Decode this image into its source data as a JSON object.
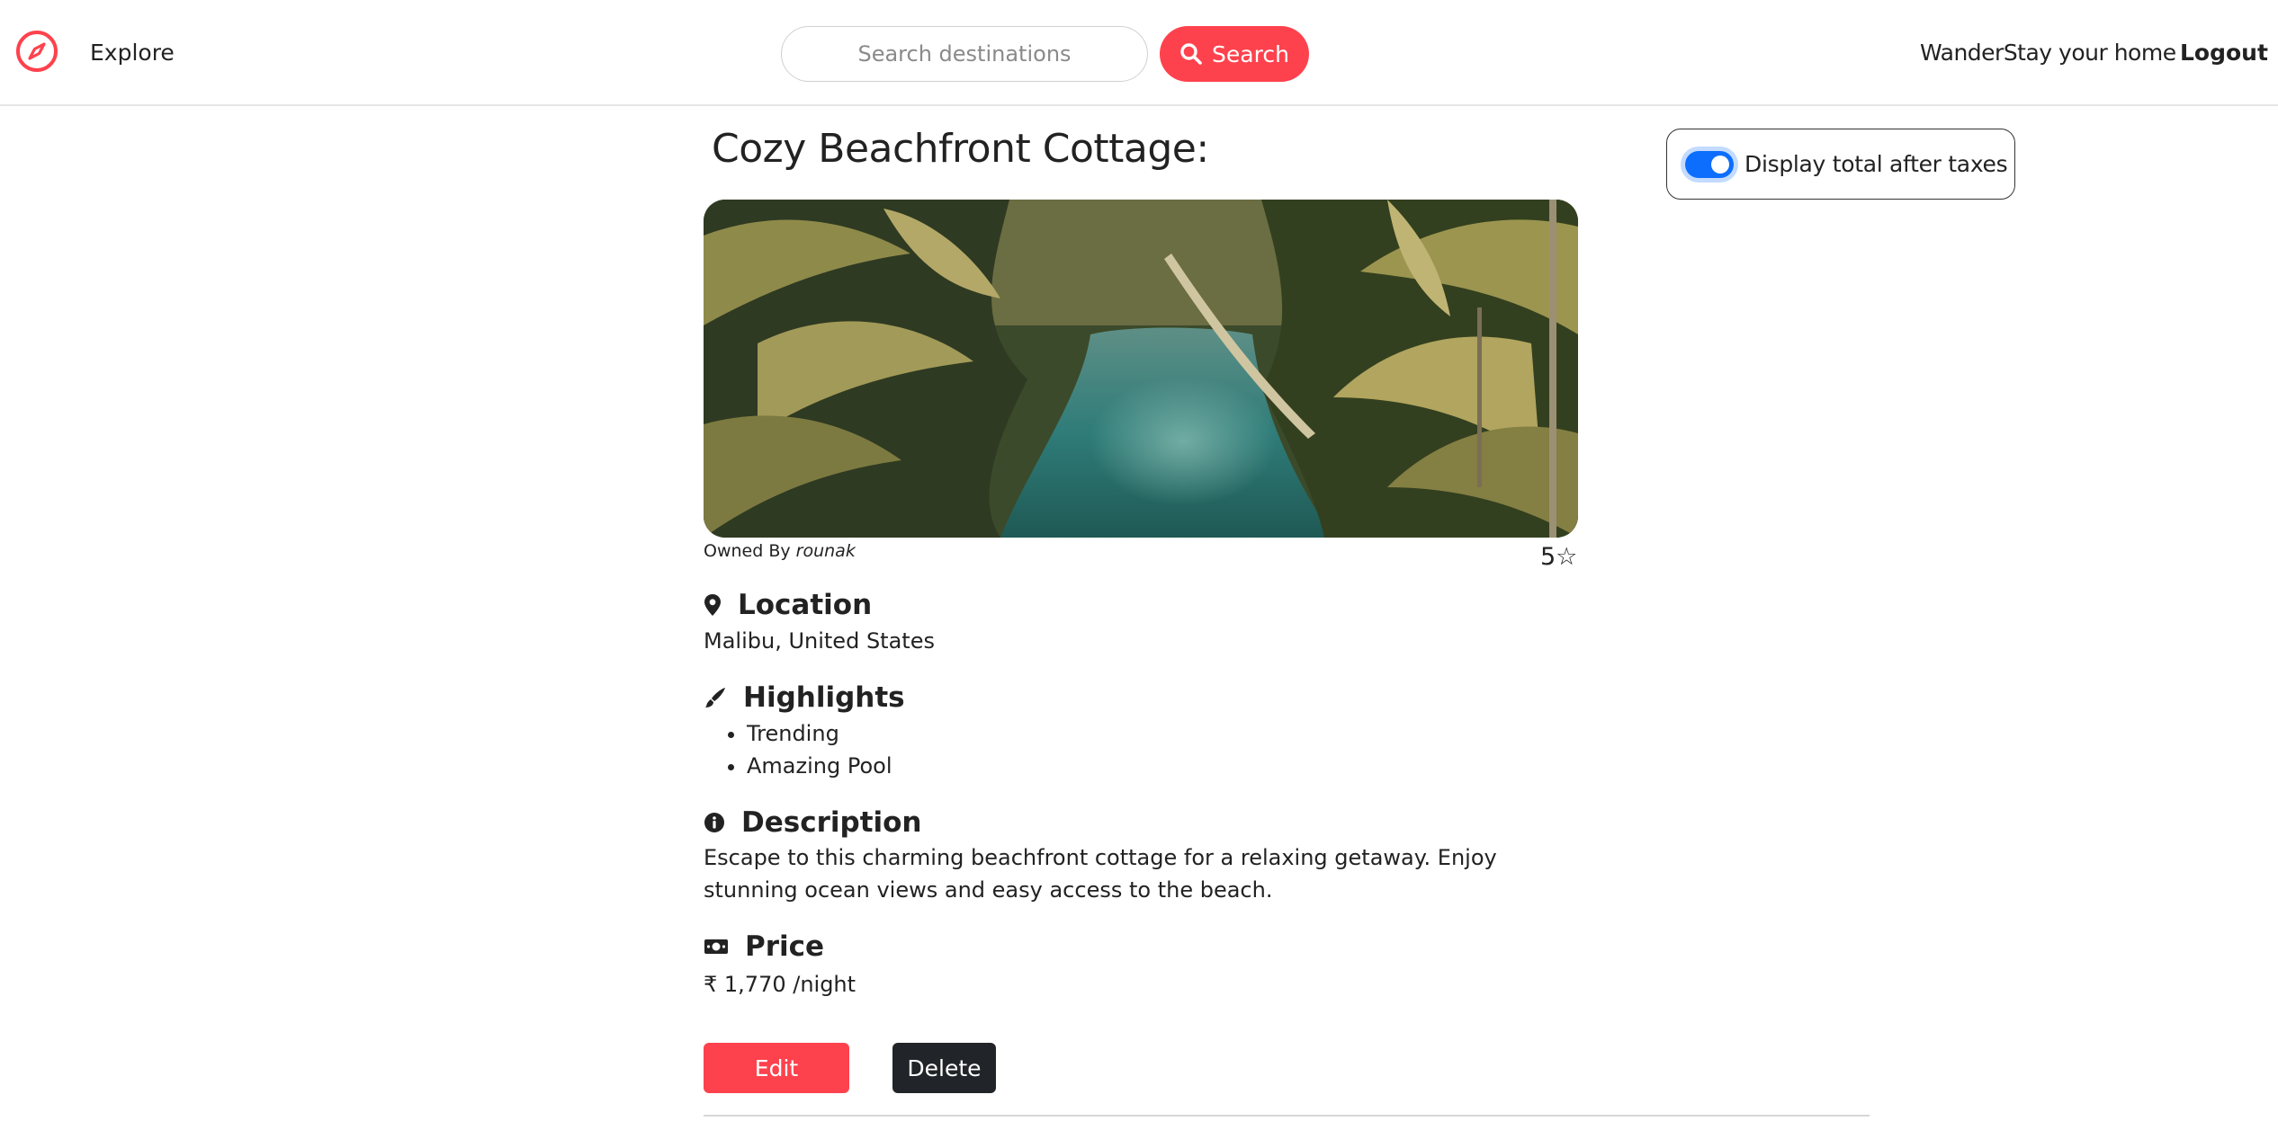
{
  "navbar": {
    "explore_label": "Explore",
    "search_placeholder": "Search destinations",
    "search_button_label": "Search",
    "home_label": "WanderStay your home",
    "logout_label": "Logout"
  },
  "tax_toggle": {
    "label": "Display total after taxes",
    "checked": true
  },
  "listing": {
    "title": "Cozy Beachfront Cottage:",
    "owner_prefix": "Owned By",
    "owner_name": "rounak",
    "rating": "5☆",
    "location_heading": "Location",
    "location_value": "Malibu, United States",
    "highlights_heading": "Highlights",
    "highlights": [
      "Trending",
      "Amazing Pool"
    ],
    "description_heading": "Description",
    "description": "Escape to this charming beachfront cottage for a relaxing getaway. Enjoy stunning ocean views and easy access to the beach.",
    "price_heading": "Price",
    "price": "₹ 1,770 /night",
    "edit_label": "Edit",
    "delete_label": "Delete"
  },
  "colors": {
    "brand": "#fe424d",
    "dark_button": "#212529",
    "toggle_blue": "#0d6efd"
  },
  "icons": {
    "logo": "compass-icon",
    "search": "search-icon",
    "location": "map-pin-icon",
    "highlights": "brush-icon",
    "description": "info-circle-icon",
    "price": "money-bill-icon"
  }
}
